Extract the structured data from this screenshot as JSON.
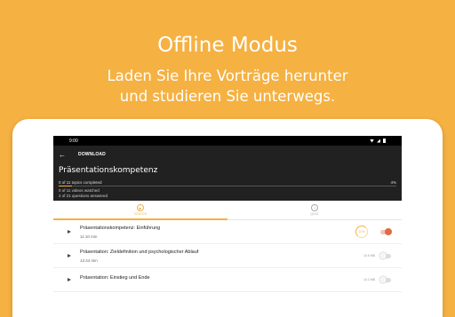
{
  "hero": {
    "title": "Offline Modus",
    "subtitle_line1": "Laden Sie Ihre Vorträge herunter",
    "subtitle_line2": "und studieren Sie unterwegs."
  },
  "statusbar": {
    "time": "9:00"
  },
  "appbar": {
    "title": "DOWNLOAD",
    "back_icon": "arrow-left-icon"
  },
  "course": {
    "title": "Präsentationskompetenz",
    "topics_completed": "0 of 11 topics completed",
    "percent": "4%",
    "progress": 0.04,
    "videos_watched": "0 of 11 videos watched",
    "questions_answered": "2 of 21 questions answered"
  },
  "tabs": [
    {
      "label": "VIDEOS",
      "icon": "play-circle-icon",
      "active": true
    },
    {
      "label": "QUIZ",
      "icon": "question-circle-icon",
      "active": false
    }
  ],
  "lectures": [
    {
      "title": "Präsentationskompetenz: Einführung",
      "duration": "11:10 min",
      "download_progress": "21%",
      "downloading": true,
      "toggle_on": true
    },
    {
      "title": "Präsentation: Zieldefinition und psychologischer Ablauf",
      "duration": "12:44 min",
      "size": "10.6 MB",
      "toggle_on": false
    },
    {
      "title": "Präsentation: Einstieg und Ende",
      "duration": "",
      "size": "10.2 MB",
      "toggle_on": false
    }
  ],
  "colors": {
    "accent": "#F5B142",
    "toggle_on": "#E06A45",
    "appbar": "#212121"
  }
}
